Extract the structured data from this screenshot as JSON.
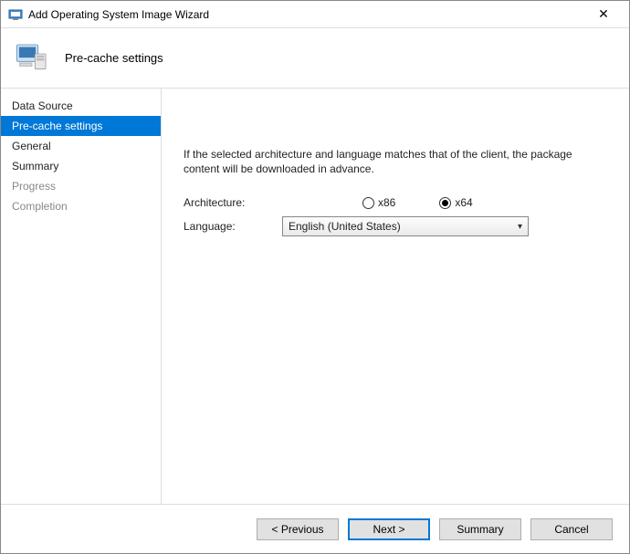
{
  "window": {
    "title": "Add Operating System Image Wizard",
    "close_glyph": "✕"
  },
  "header": {
    "step_title": "Pre-cache settings"
  },
  "sidebar": {
    "items": [
      {
        "label": "Data Source",
        "state": "normal"
      },
      {
        "label": "Pre-cache settings",
        "state": "selected"
      },
      {
        "label": "General",
        "state": "normal"
      },
      {
        "label": "Summary",
        "state": "normal"
      },
      {
        "label": "Progress",
        "state": "disabled"
      },
      {
        "label": "Completion",
        "state": "disabled"
      }
    ]
  },
  "content": {
    "description": "If the selected architecture and language matches that of the client, the package content will be downloaded in advance.",
    "architecture_label": "Architecture:",
    "arch_options": {
      "x86": "x86",
      "x64": "x64"
    },
    "arch_selected": "x64",
    "language_label": "Language:",
    "language_value": "English (United States)"
  },
  "footer": {
    "previous": "< Previous",
    "next": "Next >",
    "summary": "Summary",
    "cancel": "Cancel"
  }
}
